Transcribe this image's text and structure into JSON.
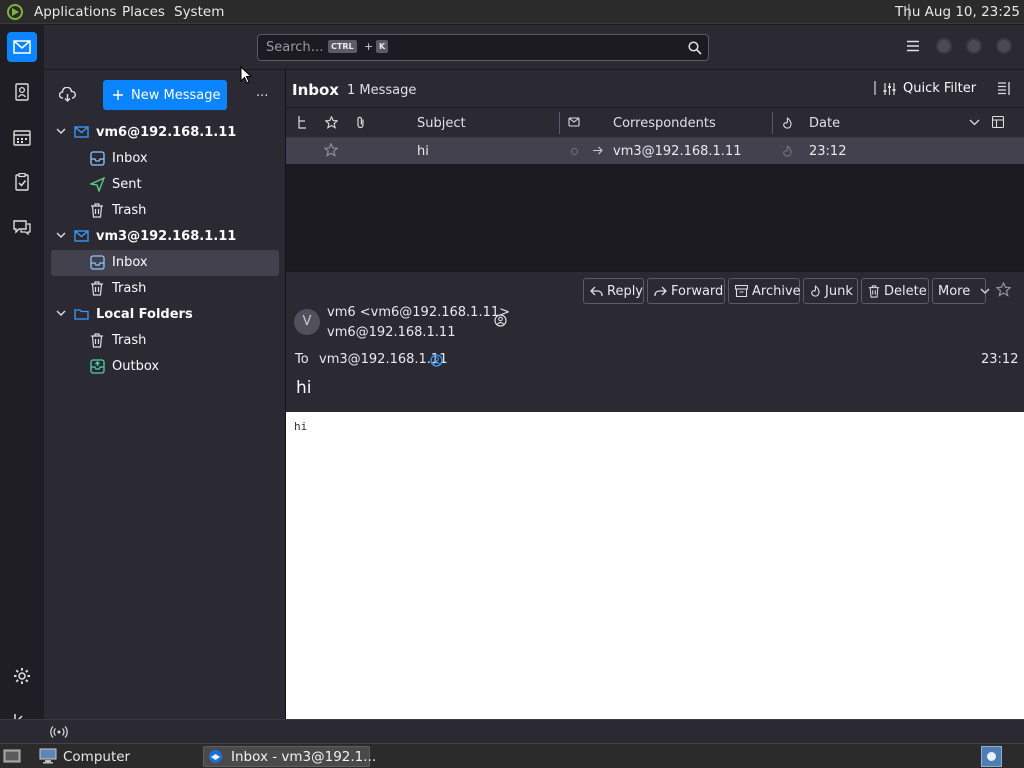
{
  "system_bar": {
    "menus": [
      "Applications",
      "Places",
      "System"
    ],
    "clock": "Thu Aug 10, 23:25"
  },
  "toolbar": {
    "search_placeholder": "Search…",
    "shortcut_key1": "CTRL",
    "shortcut_plus": "+",
    "shortcut_key2": "K"
  },
  "folder_pane": {
    "new_message_label": "New Message",
    "more_label": "...",
    "accounts": [
      {
        "name": "vm6@192.168.1.11",
        "folders": [
          "Inbox",
          "Sent",
          "Trash"
        ]
      },
      {
        "name": "vm3@192.168.1.11",
        "folders": [
          "Inbox",
          "Trash"
        ]
      },
      {
        "name": "Local Folders",
        "folders": [
          "Trash",
          "Outbox"
        ]
      }
    ]
  },
  "thread_pane": {
    "folder_title": "Inbox",
    "message_count": "1 Message",
    "quick_filter_label": "Quick Filter",
    "columns": {
      "subject": "Subject",
      "correspondents": "Correspondents",
      "date": "Date"
    },
    "rows": [
      {
        "subject": "hi",
        "correspondent": "vm3@192.168.1.11",
        "date": "23:12"
      }
    ]
  },
  "message": {
    "buttons": [
      "Reply",
      "Forward",
      "Archive",
      "Junk",
      "Delete",
      "More"
    ],
    "avatar_letter": "V",
    "from_display": "vm6 <vm6@192.168.1.11>",
    "from_address": "vm6@192.168.1.11",
    "to_label": "To",
    "to_address": "vm3@192.168.1.11",
    "time": "23:12",
    "subject": "hi",
    "body": "hi"
  },
  "taskbar": {
    "computer_label": "Computer",
    "window_label": "Inbox - vm3@192.1..."
  },
  "colors": {
    "accent": "#0a84ff",
    "pane_bg": "#2b2a33",
    "selection": "#42414d"
  }
}
